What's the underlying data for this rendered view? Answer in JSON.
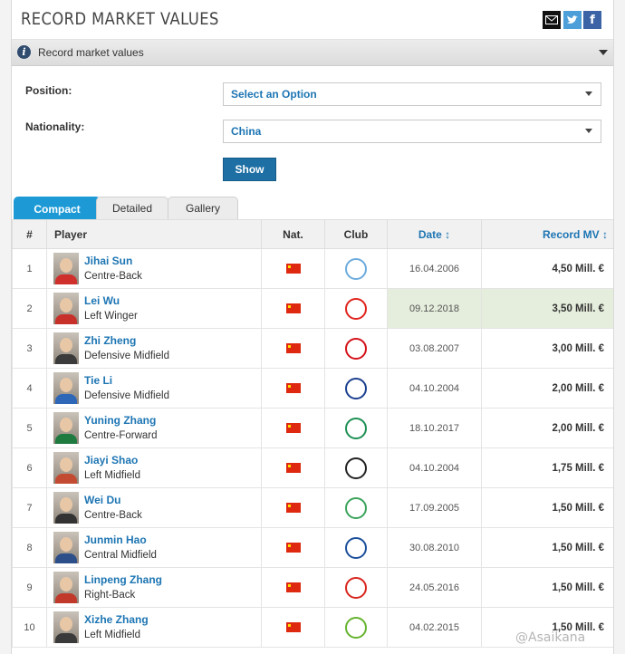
{
  "header": {
    "title": "RECORD MARKET VALUES",
    "share_icons": [
      "mail-icon",
      "twitter-icon",
      "facebook-icon"
    ]
  },
  "section": {
    "label": "Record market values"
  },
  "filters": {
    "position_label": "Position:",
    "position_value": "Select an Option",
    "nationality_label": "Nationality:",
    "nationality_value": "China",
    "show_label": "Show"
  },
  "tabs": [
    {
      "label": "Compact",
      "active": true
    },
    {
      "label": "Detailed",
      "active": false
    },
    {
      "label": "Gallery",
      "active": false
    }
  ],
  "table": {
    "headers": {
      "num": "#",
      "player": "Player",
      "nat": "Nat.",
      "club": "Club",
      "date": "Date ↕",
      "mv": "Record MV ↕"
    },
    "rows": [
      {
        "num": "1",
        "name": "Jihai Sun",
        "position": "Centre-Back",
        "club": "manchester-city-crest",
        "club_color": "#6cabdd",
        "date": "16.04.2006",
        "mv": "4,50 Mill. €"
      },
      {
        "num": "2",
        "name": "Lei Wu",
        "position": "Left Winger",
        "club": "shanghai-sipg-crest",
        "club_color": "#e0231c",
        "date": "09.12.2018",
        "mv": "3,50 Mill. €",
        "highlight": true
      },
      {
        "num": "3",
        "name": "Zhi Zheng",
        "position": "Defensive Midfield",
        "club": "charlton-athletic-crest",
        "club_color": "#d4121a",
        "date": "03.08.2007",
        "mv": "3,00 Mill. €"
      },
      {
        "num": "4",
        "name": "Tie Li",
        "position": "Defensive Midfield",
        "club": "everton-crest",
        "club_color": "#1b3f8f",
        "date": "04.10.2004",
        "mv": "2,00 Mill. €"
      },
      {
        "num": "5",
        "name": "Yuning Zhang",
        "position": "Centre-Forward",
        "club": "werder-bremen-crest",
        "club_color": "#1d9053",
        "date": "18.10.2017",
        "mv": "2,00 Mill. €"
      },
      {
        "num": "6",
        "name": "Jiayi Shao",
        "position": "Left Midfield",
        "club": "1860-munich-crest",
        "club_color": "#222222",
        "date": "04.10.2004",
        "mv": "1,75 Mill. €"
      },
      {
        "num": "7",
        "name": "Wei Du",
        "position": "Centre-Back",
        "club": "celtic-crest",
        "club_color": "#3aa35b",
        "date": "17.09.2005",
        "mv": "1,50 Mill. €"
      },
      {
        "num": "8",
        "name": "Junmin Hao",
        "position": "Central Midfield",
        "club": "schalke-04-crest",
        "club_color": "#1a4f9c",
        "date": "30.08.2010",
        "mv": "1,50 Mill. €"
      },
      {
        "num": "9",
        "name": "Linpeng Zhang",
        "position": "Right-Back",
        "club": "guangzhou-evergrande-crest",
        "club_color": "#d9251d",
        "date": "24.05.2016",
        "mv": "1,50 Mill. €"
      },
      {
        "num": "10",
        "name": "Xizhe Zhang",
        "position": "Left Midfield",
        "club": "vfl-wolfsburg-crest",
        "club_color": "#65b32e",
        "date": "04.02.2015",
        "mv": "1,50 Mill. €"
      }
    ]
  },
  "watermark": "@Asaikana",
  "colors": {
    "accent": "#1d75b3",
    "tab_active": "#1d9ad6",
    "button": "#1d6fa4",
    "row_highlight": "#e5eedc"
  }
}
